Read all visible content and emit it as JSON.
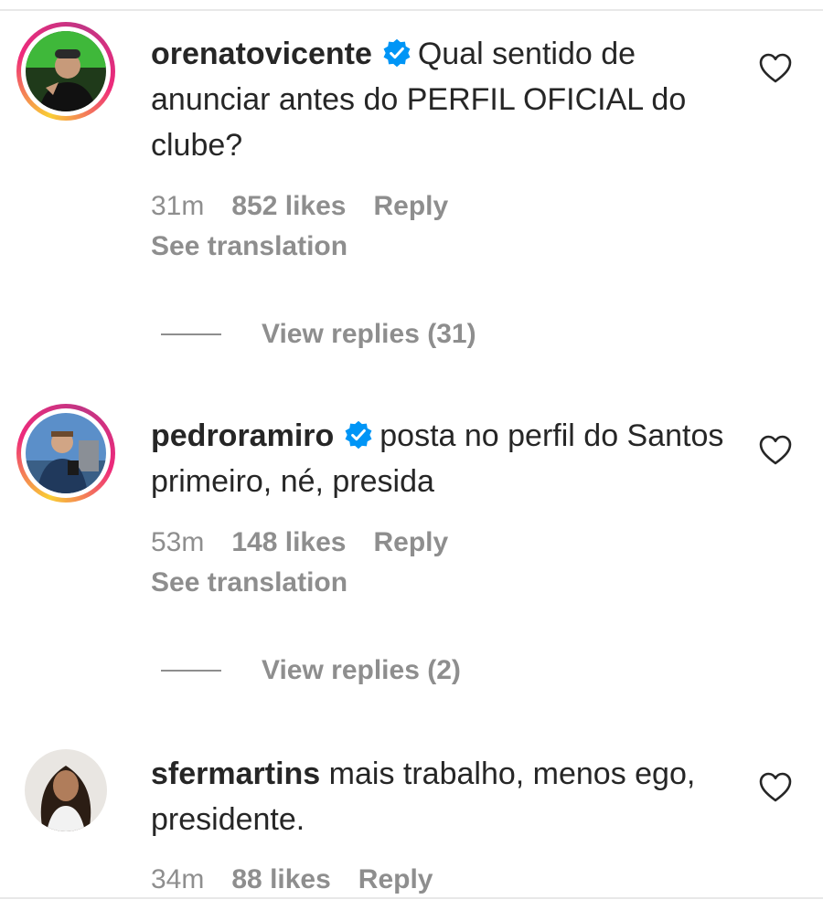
{
  "comments": [
    {
      "username": "orenatovicente",
      "verified": true,
      "text": "Qual sentido de anunciar antes do PERFIL OFICIAL do clube?",
      "time": "31m",
      "likes": "852 likes",
      "reply_label": "Reply",
      "see_translation": "See translation",
      "view_replies": "View replies (31)",
      "has_story_ring": true,
      "avatar_icon": "user-avatar-green-background"
    },
    {
      "username": "pedroramiro",
      "verified": true,
      "text": "posta no perfil do Santos primeiro, né, presida",
      "time": "53m",
      "likes": "148 likes",
      "reply_label": "Reply",
      "see_translation": "See translation",
      "view_replies": "View replies (2)",
      "has_story_ring": true,
      "avatar_icon": "user-avatar-blue-sky"
    },
    {
      "username": "sfermartins",
      "verified": false,
      "text": "mais trabalho, menos ego, presidente.",
      "time": "34m",
      "likes": "88 likes",
      "reply_label": "Reply",
      "has_story_ring": false,
      "avatar_icon": "user-avatar-woman"
    }
  ],
  "colors": {
    "text": "#262626",
    "secondary": "#8e8e8e",
    "verified": "#0095f6",
    "divider": "#e8e8e8"
  }
}
